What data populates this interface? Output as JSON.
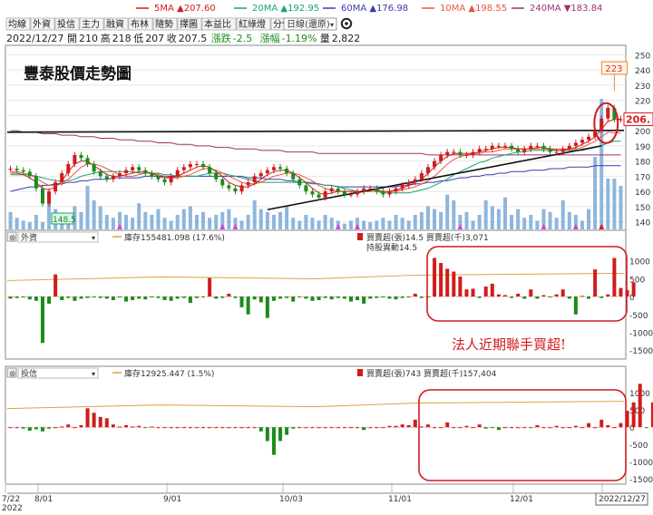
{
  "legend": [
    {
      "text": "5MA ▲207.60",
      "color": "#d01c1c"
    },
    {
      "text": "20MA ▲192.95",
      "color": "#1aa36b"
    },
    {
      "text": "60MA ▲176.98",
      "color": "#3a3ab0"
    },
    {
      "text": "10MA ▲198.55",
      "color": "#e8553e"
    },
    {
      "text": "240MA ▼183.84",
      "color": "#a0306e"
    }
  ],
  "tabs": [
    "均線",
    "外資",
    "投信",
    "主力",
    "融資",
    "布林",
    "隨勢",
    "擇圖",
    "本益比",
    "紅綠燈",
    "分價圖"
  ],
  "period_select": "日線(還原)",
  "quote": {
    "date": "2022/12/27",
    "open_label": "開",
    "open": "210",
    "high_label": "高",
    "high": "218",
    "low_label": "低",
    "low": "207",
    "close_label": "收",
    "close": "207.5",
    "chg_label": "漲跌",
    "chg": "-2.5",
    "pct_label": "漲幅",
    "pct": "-1.19%",
    "vol_label": "量",
    "vol": "2,822"
  },
  "annotations": {
    "price_title": "豐泰股價走勢圖",
    "peak_label": "223",
    "low_label": "148.5",
    "last_price": "206.",
    "insti_text": "法人近期聯手買超!"
  },
  "panel1": {
    "name": "外資",
    "holding": "庫存155481.098 (17.6%)",
    "buy_label": "買賣超(張)14.5 買賣超(千)3,071",
    "hold_change": "持股異動14.5"
  },
  "panel2": {
    "name": "投信",
    "holding": "庫存12925.447 (1.5%)",
    "buy_label": "買賣超(張)743 買賣超(千)157,404"
  },
  "x_ticks": [
    "7/22\n2022",
    "8/01",
    "9/01",
    "10/03",
    "11/01",
    "12/01",
    "2022/12/27"
  ],
  "chart_data": [
    {
      "type": "line",
      "title": "豐泰股價走勢圖",
      "y_ticks": [
        140,
        150,
        160,
        170,
        180,
        190,
        200,
        210,
        220,
        230,
        240,
        250
      ],
      "ylim": [
        135,
        255
      ],
      "close_series": [
        175,
        174,
        173,
        170,
        162,
        152,
        160,
        166,
        172,
        178,
        184,
        182,
        178,
        173,
        170,
        168,
        170,
        172,
        174,
        176,
        174,
        172,
        170,
        168,
        166,
        170,
        174,
        176,
        178,
        178,
        176,
        172,
        168,
        164,
        162,
        160,
        164,
        166,
        170,
        172,
        174,
        176,
        175,
        172,
        168,
        164,
        160,
        158,
        156,
        160,
        162,
        160,
        158,
        158,
        160,
        162,
        162,
        160,
        158,
        160,
        162,
        164,
        166,
        168,
        172,
        176,
        180,
        184,
        186,
        186,
        184,
        184,
        186,
        188,
        188,
        190,
        190,
        190,
        188,
        186,
        188,
        190,
        190,
        188,
        186,
        186,
        188,
        190,
        192,
        194,
        196,
        200,
        208,
        215,
        207.5,
        207.5
      ],
      "ma5": [
        172,
        172,
        171,
        169,
        166,
        162,
        161,
        163,
        167,
        173,
        178,
        180,
        180,
        177,
        174,
        171,
        170,
        170,
        171,
        172,
        173,
        173,
        172,
        170,
        169,
        169,
        170,
        172,
        174,
        176,
        177,
        176,
        173,
        170,
        166,
        164,
        163,
        163,
        165,
        168,
        171,
        173,
        174,
        174,
        172,
        169,
        166,
        162,
        159,
        158,
        159,
        160,
        160,
        160,
        160,
        160,
        161,
        161,
        160,
        160,
        161,
        162,
        164,
        166,
        168,
        172,
        176,
        180,
        183,
        185,
        185,
        185,
        185,
        186,
        187,
        188,
        189,
        189,
        189,
        188,
        188,
        188,
        189,
        189,
        188,
        187,
        187,
        188,
        189,
        191,
        193,
        196,
        201,
        206,
        207.6,
        207.6
      ],
      "ma10": [
        173,
        173,
        172,
        171,
        169,
        166,
        164,
        164,
        165,
        168,
        172,
        176,
        178,
        178,
        177,
        175,
        173,
        171,
        170,
        170,
        171,
        172,
        172,
        171,
        170,
        169,
        169,
        170,
        171,
        173,
        175,
        175,
        174,
        172,
        170,
        168,
        166,
        165,
        165,
        166,
        168,
        170,
        171,
        172,
        172,
        171,
        169,
        167,
        164,
        162,
        161,
        160,
        160,
        160,
        160,
        160,
        160,
        160,
        160,
        160,
        160,
        161,
        162,
        163,
        165,
        167,
        170,
        174,
        178,
        181,
        183,
        184,
        185,
        185,
        186,
        186,
        187,
        188,
        188,
        188,
        188,
        188,
        188,
        188,
        188,
        188,
        188,
        188,
        188,
        189,
        191,
        193,
        196,
        199,
        198.5,
        198.5
      ],
      "ma20": [
        171,
        171,
        171,
        171,
        170,
        169,
        168,
        167,
        167,
        167,
        168,
        170,
        171,
        172,
        173,
        173,
        173,
        173,
        173,
        173,
        172,
        172,
        172,
        172,
        171,
        171,
        170,
        170,
        170,
        170,
        171,
        172,
        172,
        172,
        171,
        170,
        169,
        168,
        167,
        166,
        166,
        166,
        166,
        166,
        166,
        166,
        166,
        166,
        165,
        164,
        164,
        163,
        162,
        161,
        160,
        160,
        160,
        160,
        159,
        159,
        159,
        159,
        159,
        160,
        161,
        162,
        164,
        166,
        168,
        171,
        173,
        175,
        177,
        179,
        180,
        182,
        183,
        184,
        185,
        186,
        186,
        187,
        187,
        187,
        187,
        187,
        187,
        187,
        187,
        187,
        188,
        189,
        190,
        192,
        193,
        193
      ],
      "ma60": [
        160,
        161,
        162,
        163,
        163,
        164,
        164,
        165,
        165,
        166,
        166,
        167,
        167,
        168,
        168,
        168,
        169,
        169,
        169,
        169,
        169,
        170,
        170,
        170,
        170,
        170,
        170,
        170,
        170,
        170,
        170,
        170,
        170,
        170,
        170,
        170,
        170,
        169,
        169,
        169,
        168,
        168,
        168,
        167,
        167,
        166,
        166,
        165,
        165,
        164,
        164,
        163,
        163,
        163,
        163,
        163,
        163,
        163,
        163,
        163,
        163,
        164,
        164,
        165,
        165,
        166,
        166,
        167,
        167,
        168,
        169,
        169,
        170,
        170,
        171,
        171,
        172,
        172,
        173,
        173,
        173,
        174,
        174,
        174,
        175,
        175,
        175,
        176,
        176,
        176,
        176,
        177,
        177,
        177,
        177,
        177
      ],
      "ma240": [
        200,
        200,
        199,
        199,
        199,
        198,
        198,
        198,
        197,
        197,
        197,
        196,
        196,
        196,
        195,
        195,
        195,
        194,
        194,
        194,
        193,
        193,
        193,
        192,
        192,
        192,
        191,
        191,
        191,
        190,
        190,
        190,
        189,
        189,
        189,
        188,
        188,
        188,
        188,
        187,
        187,
        187,
        187,
        186,
        186,
        186,
        186,
        186,
        185,
        185,
        185,
        185,
        185,
        185,
        185,
        185,
        185,
        185,
        185,
        185,
        185,
        185,
        185,
        185,
        185,
        184,
        184,
        184,
        184,
        184,
        184,
        184,
        184,
        184,
        184,
        184,
        184,
        184,
        184,
        184,
        184,
        184,
        184,
        184,
        184,
        184,
        184,
        184,
        184,
        184,
        184,
        184,
        184,
        184,
        184,
        184
      ],
      "volume": [
        0.12,
        0.08,
        0.06,
        0.05,
        0.1,
        0.05,
        0.22,
        0.14,
        0.1,
        0.06,
        0.16,
        0.12,
        0.3,
        0.2,
        0.16,
        0.1,
        0.08,
        0.12,
        0.1,
        0.08,
        0.18,
        0.12,
        0.1,
        0.14,
        0.08,
        0.06,
        0.1,
        0.14,
        0.16,
        0.1,
        0.12,
        0.08,
        0.1,
        0.12,
        0.14,
        0.08,
        0.06,
        0.1,
        0.2,
        0.14,
        0.12,
        0.1,
        0.12,
        0.16,
        0.08,
        0.06,
        0.1,
        0.08,
        0.06,
        0.1,
        0.08,
        0.06,
        0.04,
        0.06,
        0.08,
        0.06,
        0.05,
        0.06,
        0.08,
        0.06,
        0.1,
        0.08,
        0.06,
        0.1,
        0.12,
        0.16,
        0.14,
        0.12,
        0.24,
        0.2,
        0.1,
        0.12,
        0.06,
        0.1,
        0.2,
        0.16,
        0.14,
        0.22,
        0.1,
        0.14,
        0.08,
        0.1,
        0.06,
        0.14,
        0.12,
        0.08,
        0.2,
        0.12,
        0.1,
        0.06,
        0.14,
        0.5,
        0.9,
        0.35,
        0.35,
        0.3
      ],
      "support_line_from": [
        40,
        148
      ],
      "support_line_to": [
        92,
        190
      ],
      "resistance_level": 199
    },
    {
      "type": "bar",
      "title": "外資",
      "y_ticks": [
        1000,
        500,
        0,
        -500,
        -1000,
        -1500
      ],
      "ylim": [
        -1700,
        1500
      ],
      "values": [
        -60,
        -40,
        -20,
        -80,
        -120,
        -1300,
        -200,
        620,
        -100,
        -40,
        -120,
        -60,
        -40,
        -20,
        -40,
        -60,
        -100,
        -20,
        -140,
        -100,
        -60,
        -80,
        -20,
        -40,
        -100,
        -120,
        -60,
        -40,
        -180,
        -40,
        -20,
        520,
        -60,
        -40,
        80,
        -40,
        -300,
        -500,
        -80,
        -160,
        -600,
        -120,
        -60,
        -40,
        -140,
        -20,
        -60,
        -120,
        -100,
        -40,
        -80,
        -40,
        -60,
        -140,
        -100,
        -200,
        -60,
        -40,
        -20,
        -60,
        -80,
        -40,
        -20,
        80,
        -40,
        -20,
        1080,
        940,
        780,
        700,
        560,
        200,
        220,
        -40,
        280,
        360,
        60,
        40,
        -40,
        80,
        -60,
        200,
        -60,
        40,
        -20,
        60,
        200,
        -60,
        -500,
        20,
        -60,
        760,
        -40,
        60,
        1080,
        240,
        180,
        400
      ],
      "holding_line": 600
    },
    {
      "type": "bar",
      "title": "投信",
      "y_ticks": [
        1000,
        500,
        0,
        -500,
        -1000,
        -1500
      ],
      "ylim": [
        -1600,
        1400
      ],
      "values": [
        0,
        0,
        -40,
        -100,
        -60,
        -120,
        -40,
        0,
        20,
        80,
        0,
        60,
        550,
        420,
        300,
        260,
        80,
        20,
        60,
        20,
        40,
        -20,
        20,
        0,
        0,
        0,
        0,
        0,
        0,
        0,
        0,
        0,
        0,
        0,
        0,
        0,
        0,
        0,
        0,
        -120,
        -400,
        -800,
        -400,
        -220,
        -40,
        0,
        0,
        0,
        0,
        0,
        0,
        0,
        0,
        0,
        0,
        -80,
        0,
        0,
        0,
        40,
        40,
        80,
        60,
        220,
        20,
        80,
        0,
        0,
        140,
        0,
        0,
        40,
        0,
        80,
        -40,
        -20,
        -80,
        0,
        0,
        0,
        0,
        -20,
        60,
        0,
        0,
        40,
        0,
        0,
        40,
        0,
        120,
        0,
        220,
        60,
        0,
        120,
        480,
        720,
        1260,
        -20,
        720
      ],
      "holding_line": 700
    }
  ]
}
